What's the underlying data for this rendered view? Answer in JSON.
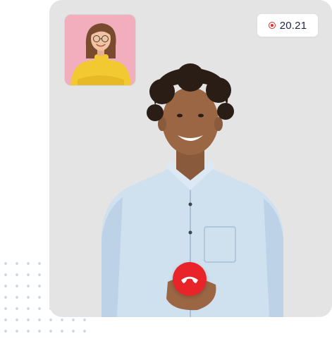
{
  "recording": {
    "indicator_icon": "record-icon",
    "timer": "20.21"
  },
  "controls": {
    "end_call_icon": "phone-hangup-icon"
  },
  "colors": {
    "end_call": "#e8232a",
    "record": "#e02b2b",
    "card_background": "#e4e4e4",
    "self_view_background": "#f2aebd"
  }
}
